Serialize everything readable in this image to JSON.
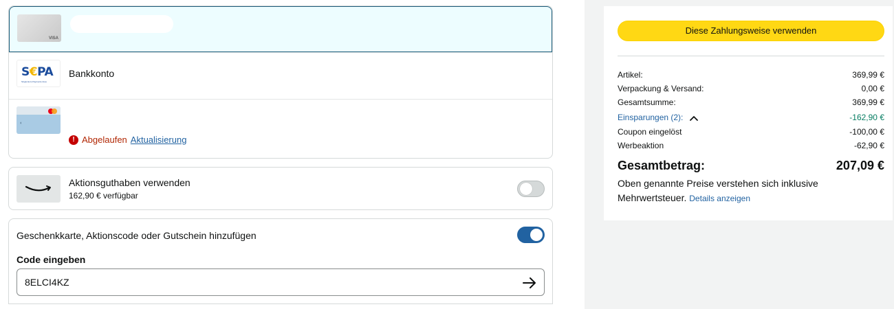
{
  "payment_methods": {
    "visa": {
      "brand": "VISA"
    },
    "sepa": {
      "title": "Bankkonto",
      "logo_text_s": "S",
      "logo_text_e": "€",
      "logo_text_pa": "PA",
      "logo_tagline": "Single Euro Payments Area"
    },
    "mastercard": {
      "expired_label": "Abgelaufen",
      "update_link": "Aktualisierung"
    }
  },
  "promo_credit": {
    "title": "Aktionsguthaben verwenden",
    "available": "162,90 € verfügbar",
    "enabled": false
  },
  "gift_card": {
    "title": "Geschenkkarte, Aktionscode oder Gutschein hinzufügen",
    "enabled": true,
    "code_label": "Code eingeben",
    "code_value": "8ELCI4KZ"
  },
  "summary": {
    "button_label": "Diese Zahlungsweise verwenden",
    "lines": [
      {
        "label": "Artikel:",
        "value": "369,99 €"
      },
      {
        "label": "Verpackung & Versand:",
        "value": "0,00 €"
      },
      {
        "label": "Gesamtsumme:",
        "value": "369,99 €"
      },
      {
        "label": "Einsparungen (2):",
        "value": "-162,90 €"
      },
      {
        "label": "Coupon eingelöst",
        "value": "-100,00 €"
      },
      {
        "label": "Werbeaktion",
        "value": "-62,90 €"
      }
    ],
    "total_label": "Gesamtbetrag:",
    "total_value": "207,09 €",
    "vat_text": "Oben genannte Preise verstehen sich inklusive Mehrwertsteuer.",
    "details_link": "Details anzeigen"
  },
  "colors": {
    "button_yellow": "#ffd814",
    "link_blue": "#2162a1",
    "savings_green": "#067d62",
    "error_red": "#c40000",
    "toggle_on": "#2162a1",
    "selected_bg": "#edfdff"
  }
}
